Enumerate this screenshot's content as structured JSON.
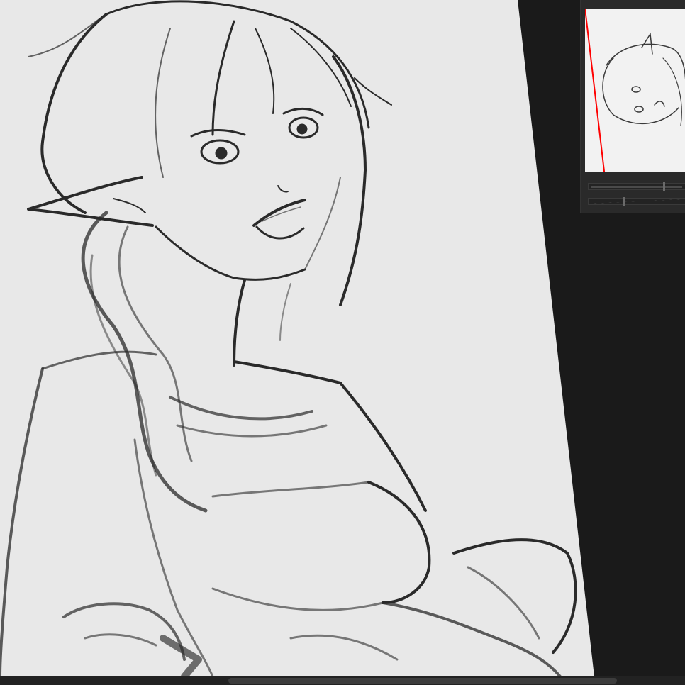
{
  "app": {
    "canvas_background": "#1a1a1a",
    "paper_color": "#e8e8e8",
    "line_color": "#2a2a2a",
    "panel_color": "#2a2a2a",
    "scrollbar_color": "#222222",
    "scroll_thumb_color": "#3c3c3c",
    "view_rotation_indicator_color": "#ff0000"
  },
  "canvas": {
    "artwork_subject": "line-sketch-elf-girl"
  },
  "navigator": {
    "icons": {
      "rotate": "rotate-slider-icon",
      "zoom": "zoom-slider-icon"
    }
  },
  "scrollbar": {
    "orientation": "horizontal"
  }
}
